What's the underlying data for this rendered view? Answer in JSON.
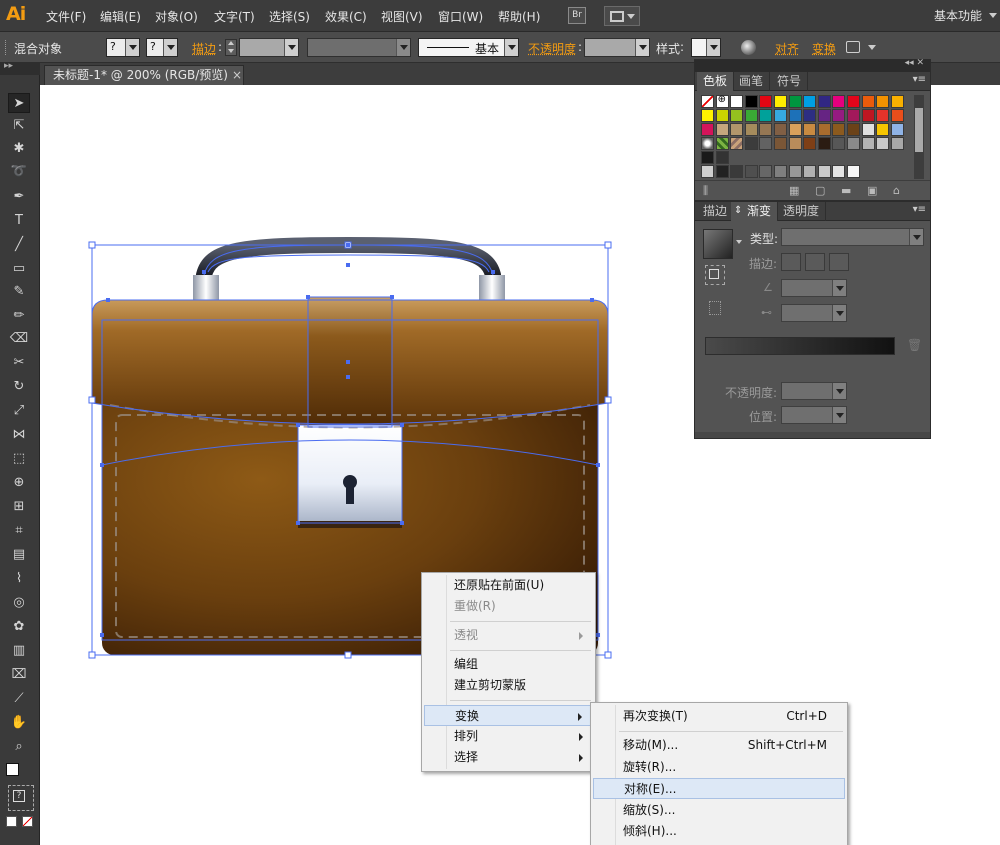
{
  "app": {
    "logo": "Ai"
  },
  "menubar": {
    "items": [
      "文件(F)",
      "编辑(E)",
      "对象(O)",
      "文字(T)",
      "选择(S)",
      "效果(C)",
      "视图(V)",
      "窗口(W)",
      "帮助(H)"
    ],
    "bridge_label": "Br",
    "workspace": "基本功能"
  },
  "controlbar": {
    "selection_label": "混合对象",
    "stroke_label": "描边",
    "stroke_style": "基本",
    "opacity_label": "不透明度",
    "style_label": "样式",
    "align_label": "对齐",
    "transform_label": "变换",
    "fill_placeholder": "?",
    "stroke_placeholder": "?"
  },
  "document": {
    "tab_title": "未标题-1* @ 200% (RGB/预览)",
    "close_glyph": "×"
  },
  "swatch_panel": {
    "tabs": [
      "色板",
      "画笔",
      "符号"
    ]
  },
  "gradient_panel": {
    "tabs": [
      "描边",
      "渐变",
      "透明度"
    ],
    "type_label": "类型:",
    "stroke_label": "描边:",
    "opacity_label": "不透明度:",
    "position_label": "位置:"
  },
  "context_menu": {
    "items": [
      {
        "label": "还原贴在前面(U)",
        "enabled": true
      },
      {
        "label": "重做(R)",
        "enabled": false
      },
      {
        "label": "透视",
        "enabled": false,
        "submenu": true
      },
      {
        "label": "编组",
        "enabled": true
      },
      {
        "label": "建立剪切蒙版",
        "enabled": true
      },
      {
        "label": "变换",
        "enabled": true,
        "submenu": true,
        "highlighted": true
      },
      {
        "label": "排列",
        "enabled": true,
        "submenu": true
      },
      {
        "label": "选择",
        "enabled": true,
        "submenu": true
      }
    ]
  },
  "transform_submenu": {
    "items": [
      {
        "label": "再次变换(T)",
        "shortcut": "Ctrl+D"
      },
      {
        "label": "移动(M)...",
        "shortcut": "Shift+Ctrl+M"
      },
      {
        "label": "旋转(R)...",
        "shortcut": ""
      },
      {
        "label": "对称(E)...",
        "shortcut": "",
        "highlighted": true
      },
      {
        "label": "缩放(S)...",
        "shortcut": ""
      },
      {
        "label": "倾斜(H)...",
        "shortcut": ""
      }
    ]
  },
  "colors": {
    "accent_orange": "#f39c12",
    "highlight": "#dde8f6",
    "selection_blue": "#4a6cf0"
  }
}
